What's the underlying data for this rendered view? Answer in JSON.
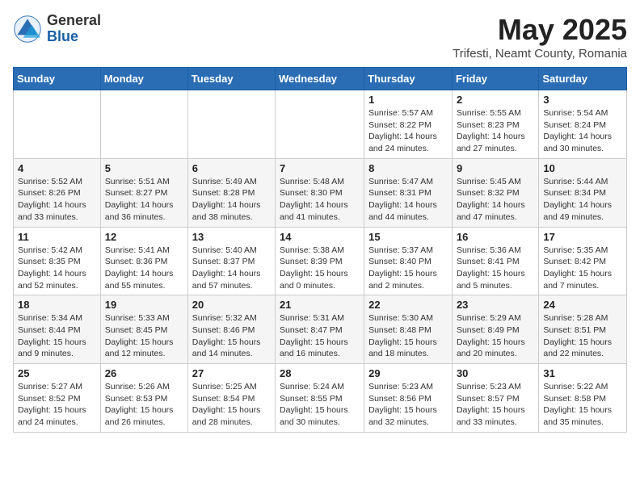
{
  "header": {
    "logo_general": "General",
    "logo_blue": "Blue",
    "month": "May 2025",
    "location": "Trifesti, Neamt County, Romania"
  },
  "days_of_week": [
    "Sunday",
    "Monday",
    "Tuesday",
    "Wednesday",
    "Thursday",
    "Friday",
    "Saturday"
  ],
  "weeks": [
    [
      {
        "num": "",
        "detail": ""
      },
      {
        "num": "",
        "detail": ""
      },
      {
        "num": "",
        "detail": ""
      },
      {
        "num": "",
        "detail": ""
      },
      {
        "num": "1",
        "detail": "Sunrise: 5:57 AM\nSunset: 8:22 PM\nDaylight: 14 hours and 24 minutes."
      },
      {
        "num": "2",
        "detail": "Sunrise: 5:55 AM\nSunset: 8:23 PM\nDaylight: 14 hours and 27 minutes."
      },
      {
        "num": "3",
        "detail": "Sunrise: 5:54 AM\nSunset: 8:24 PM\nDaylight: 14 hours and 30 minutes."
      }
    ],
    [
      {
        "num": "4",
        "detail": "Sunrise: 5:52 AM\nSunset: 8:26 PM\nDaylight: 14 hours and 33 minutes."
      },
      {
        "num": "5",
        "detail": "Sunrise: 5:51 AM\nSunset: 8:27 PM\nDaylight: 14 hours and 36 minutes."
      },
      {
        "num": "6",
        "detail": "Sunrise: 5:49 AM\nSunset: 8:28 PM\nDaylight: 14 hours and 38 minutes."
      },
      {
        "num": "7",
        "detail": "Sunrise: 5:48 AM\nSunset: 8:30 PM\nDaylight: 14 hours and 41 minutes."
      },
      {
        "num": "8",
        "detail": "Sunrise: 5:47 AM\nSunset: 8:31 PM\nDaylight: 14 hours and 44 minutes."
      },
      {
        "num": "9",
        "detail": "Sunrise: 5:45 AM\nSunset: 8:32 PM\nDaylight: 14 hours and 47 minutes."
      },
      {
        "num": "10",
        "detail": "Sunrise: 5:44 AM\nSunset: 8:34 PM\nDaylight: 14 hours and 49 minutes."
      }
    ],
    [
      {
        "num": "11",
        "detail": "Sunrise: 5:42 AM\nSunset: 8:35 PM\nDaylight: 14 hours and 52 minutes."
      },
      {
        "num": "12",
        "detail": "Sunrise: 5:41 AM\nSunset: 8:36 PM\nDaylight: 14 hours and 55 minutes."
      },
      {
        "num": "13",
        "detail": "Sunrise: 5:40 AM\nSunset: 8:37 PM\nDaylight: 14 hours and 57 minutes."
      },
      {
        "num": "14",
        "detail": "Sunrise: 5:38 AM\nSunset: 8:39 PM\nDaylight: 15 hours and 0 minutes."
      },
      {
        "num": "15",
        "detail": "Sunrise: 5:37 AM\nSunset: 8:40 PM\nDaylight: 15 hours and 2 minutes."
      },
      {
        "num": "16",
        "detail": "Sunrise: 5:36 AM\nSunset: 8:41 PM\nDaylight: 15 hours and 5 minutes."
      },
      {
        "num": "17",
        "detail": "Sunrise: 5:35 AM\nSunset: 8:42 PM\nDaylight: 15 hours and 7 minutes."
      }
    ],
    [
      {
        "num": "18",
        "detail": "Sunrise: 5:34 AM\nSunset: 8:44 PM\nDaylight: 15 hours and 9 minutes."
      },
      {
        "num": "19",
        "detail": "Sunrise: 5:33 AM\nSunset: 8:45 PM\nDaylight: 15 hours and 12 minutes."
      },
      {
        "num": "20",
        "detail": "Sunrise: 5:32 AM\nSunset: 8:46 PM\nDaylight: 15 hours and 14 minutes."
      },
      {
        "num": "21",
        "detail": "Sunrise: 5:31 AM\nSunset: 8:47 PM\nDaylight: 15 hours and 16 minutes."
      },
      {
        "num": "22",
        "detail": "Sunrise: 5:30 AM\nSunset: 8:48 PM\nDaylight: 15 hours and 18 minutes."
      },
      {
        "num": "23",
        "detail": "Sunrise: 5:29 AM\nSunset: 8:49 PM\nDaylight: 15 hours and 20 minutes."
      },
      {
        "num": "24",
        "detail": "Sunrise: 5:28 AM\nSunset: 8:51 PM\nDaylight: 15 hours and 22 minutes."
      }
    ],
    [
      {
        "num": "25",
        "detail": "Sunrise: 5:27 AM\nSunset: 8:52 PM\nDaylight: 15 hours and 24 minutes."
      },
      {
        "num": "26",
        "detail": "Sunrise: 5:26 AM\nSunset: 8:53 PM\nDaylight: 15 hours and 26 minutes."
      },
      {
        "num": "27",
        "detail": "Sunrise: 5:25 AM\nSunset: 8:54 PM\nDaylight: 15 hours and 28 minutes."
      },
      {
        "num": "28",
        "detail": "Sunrise: 5:24 AM\nSunset: 8:55 PM\nDaylight: 15 hours and 30 minutes."
      },
      {
        "num": "29",
        "detail": "Sunrise: 5:23 AM\nSunset: 8:56 PM\nDaylight: 15 hours and 32 minutes."
      },
      {
        "num": "30",
        "detail": "Sunrise: 5:23 AM\nSunset: 8:57 PM\nDaylight: 15 hours and 33 minutes."
      },
      {
        "num": "31",
        "detail": "Sunrise: 5:22 AM\nSunset: 8:58 PM\nDaylight: 15 hours and 35 minutes."
      }
    ]
  ]
}
